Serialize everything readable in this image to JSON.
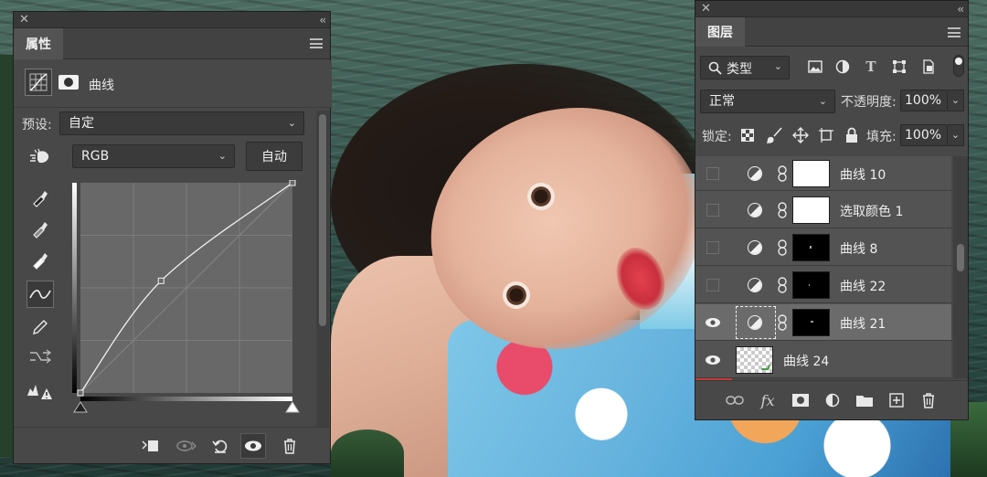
{
  "properties": {
    "tab_label": "属性",
    "title": "曲线",
    "preset_label": "预设:",
    "preset_value": "自定",
    "channel_value": "RGB",
    "auto_button": "自动"
  },
  "layers": {
    "tab_label": "图层",
    "filter_kind": "类型",
    "blend_mode": "正常",
    "opacity_label": "不透明度:",
    "opacity_value": "100%",
    "lock_label": "锁定:",
    "fill_label": "填充:",
    "fill_value": "100%",
    "items": [
      {
        "name": "曲线 10",
        "visible": false,
        "thumb": "white"
      },
      {
        "name": "选取颜色 1",
        "visible": false,
        "thumb": "white"
      },
      {
        "name": "曲线 8",
        "visible": false,
        "thumb": "black"
      },
      {
        "name": "曲线 22",
        "visible": false,
        "thumb": "black"
      },
      {
        "name": "曲线 21",
        "visible": true,
        "thumb": "black",
        "selected": true
      },
      {
        "name": "曲线 24",
        "visible": true,
        "thumb": "checker"
      }
    ]
  },
  "curve": {
    "channel": "RGB",
    "points": [
      [
        0,
        0
      ],
      [
        97,
        136
      ],
      [
        255,
        255
      ]
    ]
  },
  "colors": {
    "panel_bg": "#535353",
    "panel_dark": "#383838",
    "selected_row": "#6b6b6b",
    "accent_red": "#c23c3c"
  }
}
